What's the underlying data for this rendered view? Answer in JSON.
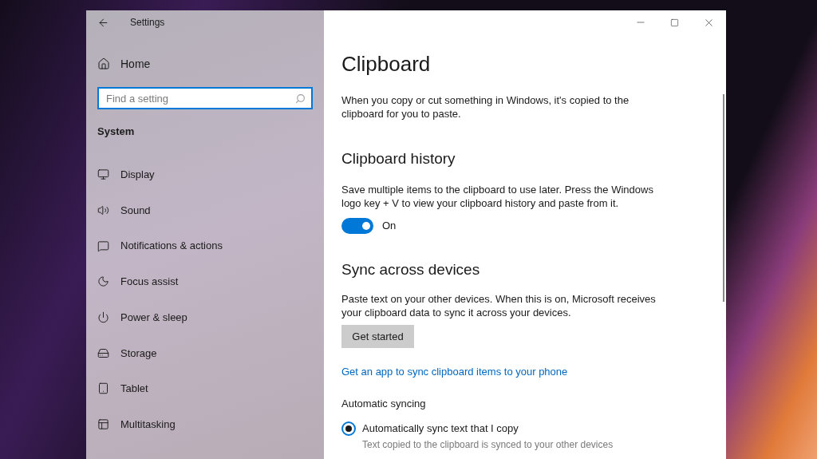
{
  "window": {
    "title": "Settings"
  },
  "sidebar": {
    "home": "Home",
    "search": {
      "placeholder": "Find a setting"
    },
    "section": "System",
    "items": [
      {
        "label": "Display"
      },
      {
        "label": "Sound"
      },
      {
        "label": "Notifications & actions"
      },
      {
        "label": "Focus assist"
      },
      {
        "label": "Power & sleep"
      },
      {
        "label": "Storage"
      },
      {
        "label": "Tablet"
      },
      {
        "label": "Multitasking"
      }
    ]
  },
  "page": {
    "title": "Clipboard",
    "intro": "When you copy or cut something in Windows, it's copied to the clipboard for you to paste.",
    "history": {
      "heading": "Clipboard history",
      "description": "Save multiple items to the clipboard to use later. Press the Windows logo key + V to view your clipboard history and paste from it.",
      "toggle": {
        "on": true,
        "label": "On"
      }
    },
    "sync": {
      "heading": "Sync across devices",
      "description": "Paste text on your other devices. When this is on, Microsoft receives your clipboard data to sync it across your devices.",
      "button": "Get started",
      "link": "Get an app to sync clipboard items to your phone",
      "subheading": "Automatic syncing",
      "options": [
        {
          "label": "Automatically sync text that I copy",
          "selected": true,
          "note": "Text copied to the clipboard is synced to your other devices"
        }
      ]
    }
  }
}
